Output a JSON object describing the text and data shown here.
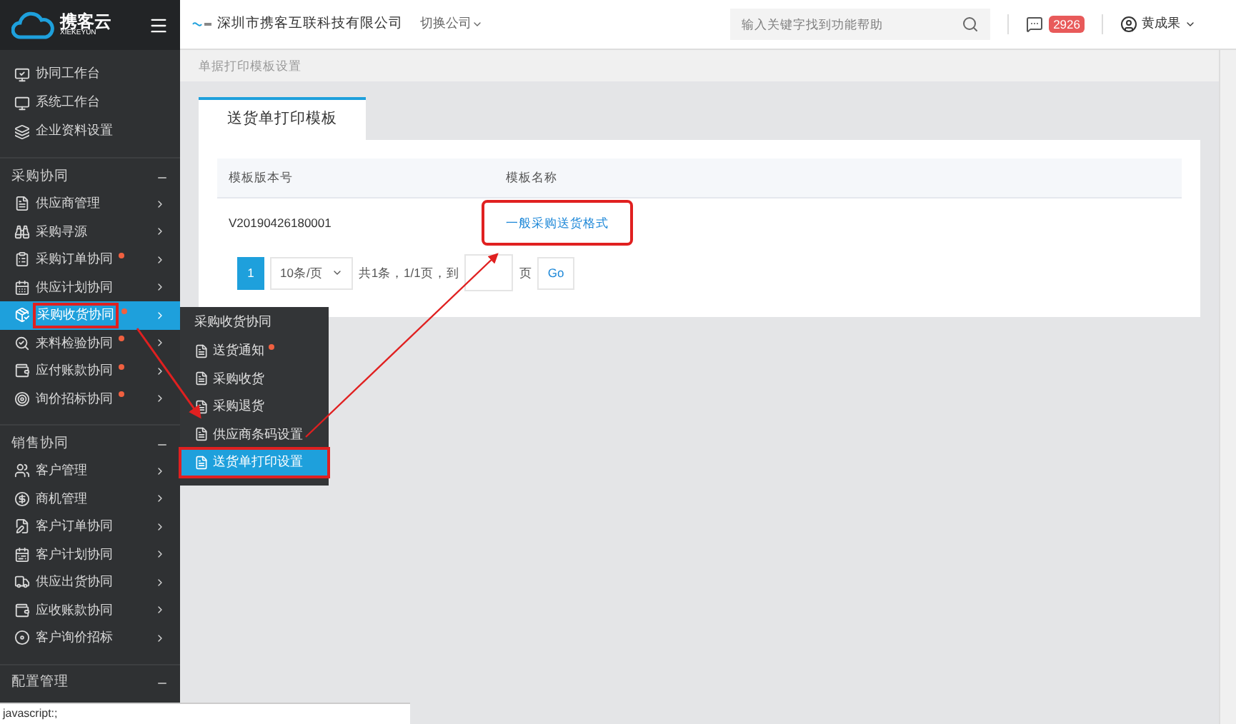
{
  "header": {
    "brand": "携客云",
    "brand_sub": "XIEKEYUN",
    "company": "深圳市携客互联科技有限公司",
    "switch_company": "切换公司",
    "search": {
      "placeholder": "输入关键字找到功能帮助"
    },
    "message_count": "2926",
    "user": "黄成果"
  },
  "sidebar": {
    "top_items": [
      {
        "label": "协同工作台"
      },
      {
        "label": "系统工作台"
      },
      {
        "label": "企业资料设置"
      }
    ],
    "sections": [
      {
        "title": "采购协同",
        "expanded": true,
        "items": [
          {
            "label": "供应商管理",
            "dot": false,
            "selected": false,
            "highlighted": false
          },
          {
            "label": "采购寻源",
            "dot": false,
            "selected": false,
            "highlighted": false
          },
          {
            "label": "采购订单协同",
            "dot": true,
            "selected": false,
            "highlighted": false
          },
          {
            "label": "供应计划协同",
            "dot": false,
            "selected": false,
            "highlighted": false
          },
          {
            "label": "采购收货协同",
            "dot": true,
            "selected": true,
            "highlighted": true
          },
          {
            "label": "来料检验协同",
            "dot": true,
            "selected": false,
            "highlighted": false
          },
          {
            "label": "应付账款协同",
            "dot": true,
            "selected": false,
            "highlighted": false
          },
          {
            "label": "询价招标协同",
            "dot": true,
            "selected": false,
            "highlighted": false
          }
        ]
      },
      {
        "title": "销售协同",
        "expanded": true,
        "items": [
          {
            "label": "客户管理",
            "dot": false,
            "selected": false,
            "highlighted": false
          },
          {
            "label": "商机管理",
            "dot": false,
            "selected": false,
            "highlighted": false
          },
          {
            "label": "客户订单协同",
            "dot": false,
            "selected": false,
            "highlighted": false
          },
          {
            "label": "客户计划协同",
            "dot": false,
            "selected": false,
            "highlighted": false
          },
          {
            "label": "供应出货协同",
            "dot": false,
            "selected": false,
            "highlighted": false
          },
          {
            "label": "应收账款协同",
            "dot": false,
            "selected": false,
            "highlighted": false
          },
          {
            "label": "客户询价招标",
            "dot": false,
            "selected": false,
            "highlighted": false
          }
        ]
      },
      {
        "title": "配置管理",
        "expanded": true
      }
    ]
  },
  "flyout": {
    "title": "采购收货协同",
    "items": [
      {
        "label": "送货通知",
        "dot": true,
        "selected": false,
        "highlighted": false
      },
      {
        "label": "采购收货",
        "dot": false,
        "selected": false,
        "highlighted": false
      },
      {
        "label": "采购退货",
        "dot": false,
        "selected": false,
        "highlighted": false
      },
      {
        "label": "供应商条码设置",
        "dot": false,
        "selected": false,
        "highlighted": false
      },
      {
        "label": "送货单打印设置",
        "dot": false,
        "selected": true,
        "highlighted": true
      }
    ]
  },
  "breadcrumb": "单据打印模板设置",
  "tabs": [
    {
      "label": "送货单打印模板",
      "selected": true
    }
  ],
  "table": {
    "columns": [
      "模板版本号",
      "模板名称"
    ],
    "rows": [
      {
        "version": "V20190426180001",
        "name": "一般采购送货格式",
        "highlighted": true
      }
    ]
  },
  "pagination": {
    "pages": [
      {
        "label": "1",
        "selected": true
      }
    ],
    "page_size": "10条/页",
    "summary": "共1条，1/1页，到",
    "page_unit": "页",
    "go": "Go"
  },
  "status_bar": "javascript:;"
}
